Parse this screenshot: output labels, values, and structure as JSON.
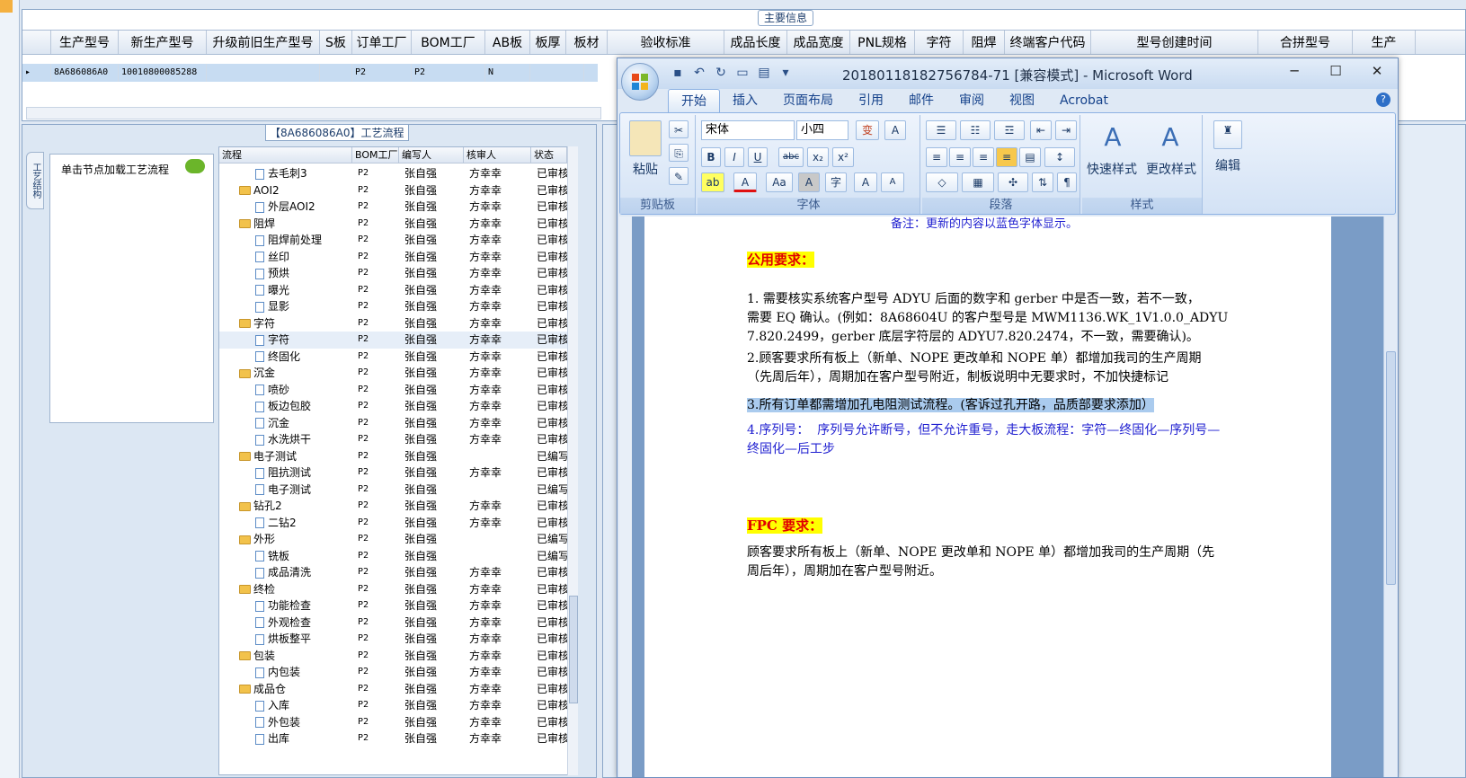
{
  "main_grid": {
    "section_label": "主要信息",
    "columns": [
      "生产型号",
      "新生产型号",
      "升级前旧生产型号",
      "S板",
      "订单工厂",
      "BOM工厂",
      "AB板",
      "板厚",
      "板材",
      "验收标准",
      "成品长度",
      "成品宽度",
      "PNL规格",
      "字符",
      "阻焊",
      "终端客户代码",
      "型号创建时间",
      "合拼型号",
      "生产"
    ],
    "row": {
      "marker": "▸",
      "model": "8A686086A0",
      "new_model": "10010800085288",
      "order_factory": "P2",
      "bom_factory": "P2",
      "ab": "N"
    }
  },
  "process_panel": {
    "title": "【8A686086A0】工艺流程",
    "vertical_tab": "工艺结构",
    "hint": "单击节点加载工艺流程",
    "headers": [
      "流程",
      "BOM工厂",
      "编写人",
      "核审人",
      "状态"
    ],
    "rows": [
      {
        "level": 2,
        "type": "doc",
        "name": "去毛刺3",
        "bom": "P2",
        "writer": "张自强",
        "checker": "方幸幸",
        "status": "已审核"
      },
      {
        "level": 1,
        "type": "folder",
        "name": "AOI2",
        "bom": "P2",
        "writer": "张自强",
        "checker": "方幸幸",
        "status": "已审核"
      },
      {
        "level": 2,
        "type": "doc",
        "name": "外层AOI2",
        "bom": "P2",
        "writer": "张自强",
        "checker": "方幸幸",
        "status": "已审核"
      },
      {
        "level": 1,
        "type": "folder",
        "name": "阻焊",
        "bom": "P2",
        "writer": "张自强",
        "checker": "方幸幸",
        "status": "已审核"
      },
      {
        "level": 2,
        "type": "doc",
        "name": "阻焊前处理",
        "bom": "P2",
        "writer": "张自强",
        "checker": "方幸幸",
        "status": "已审核"
      },
      {
        "level": 2,
        "type": "doc",
        "name": "丝印",
        "bom": "P2",
        "writer": "张自强",
        "checker": "方幸幸",
        "status": "已审核"
      },
      {
        "level": 2,
        "type": "doc",
        "name": "预烘",
        "bom": "P2",
        "writer": "张自强",
        "checker": "方幸幸",
        "status": "已审核"
      },
      {
        "level": 2,
        "type": "doc",
        "name": "曝光",
        "bom": "P2",
        "writer": "张自强",
        "checker": "方幸幸",
        "status": "已审核"
      },
      {
        "level": 2,
        "type": "doc",
        "name": "显影",
        "bom": "P2",
        "writer": "张自强",
        "checker": "方幸幸",
        "status": "已审核"
      },
      {
        "level": 1,
        "type": "folder",
        "name": "字符",
        "bom": "P2",
        "writer": "张自强",
        "checker": "方幸幸",
        "status": "已审核"
      },
      {
        "level": 2,
        "type": "doc",
        "name": "字符",
        "bom": "P2",
        "writer": "张自强",
        "checker": "方幸幸",
        "status": "已审核"
      },
      {
        "level": 2,
        "type": "doc",
        "name": "终固化",
        "bom": "P2",
        "writer": "张自强",
        "checker": "方幸幸",
        "status": "已审核"
      },
      {
        "level": 1,
        "type": "folder",
        "name": "沉金",
        "bom": "P2",
        "writer": "张自强",
        "checker": "方幸幸",
        "status": "已审核"
      },
      {
        "level": 2,
        "type": "doc",
        "name": "喷砂",
        "bom": "P2",
        "writer": "张自强",
        "checker": "方幸幸",
        "status": "已审核"
      },
      {
        "level": 2,
        "type": "doc",
        "name": "板边包胶",
        "bom": "P2",
        "writer": "张自强",
        "checker": "方幸幸",
        "status": "已审核"
      },
      {
        "level": 2,
        "type": "doc",
        "name": "沉金",
        "bom": "P2",
        "writer": "张自强",
        "checker": "方幸幸",
        "status": "已审核"
      },
      {
        "level": 2,
        "type": "doc",
        "name": "水洗烘干",
        "bom": "P2",
        "writer": "张自强",
        "checker": "方幸幸",
        "status": "已审核"
      },
      {
        "level": 1,
        "type": "folder",
        "name": "电子测试",
        "bom": "P2",
        "writer": "张自强",
        "checker": "",
        "status": "已编写"
      },
      {
        "level": 2,
        "type": "doc",
        "name": "阻抗测试",
        "bom": "P2",
        "writer": "张自强",
        "checker": "方幸幸",
        "status": "已审核"
      },
      {
        "level": 2,
        "type": "doc",
        "name": "电子测试",
        "bom": "P2",
        "writer": "张自强",
        "checker": "",
        "status": "已编写"
      },
      {
        "level": 1,
        "type": "folder",
        "name": "钻孔2",
        "bom": "P2",
        "writer": "张自强",
        "checker": "方幸幸",
        "status": "已审核"
      },
      {
        "level": 2,
        "type": "doc",
        "name": "二钻2",
        "bom": "P2",
        "writer": "张自强",
        "checker": "方幸幸",
        "status": "已审核"
      },
      {
        "level": 1,
        "type": "folder",
        "name": "外形",
        "bom": "P2",
        "writer": "张自强",
        "checker": "",
        "status": "已编写"
      },
      {
        "level": 2,
        "type": "doc",
        "name": "铣板",
        "bom": "P2",
        "writer": "张自强",
        "checker": "",
        "status": "已编写"
      },
      {
        "level": 2,
        "type": "doc",
        "name": "成品清洗",
        "bom": "P2",
        "writer": "张自强",
        "checker": "方幸幸",
        "status": "已审核"
      },
      {
        "level": 1,
        "type": "folder",
        "name": "终检",
        "bom": "P2",
        "writer": "张自强",
        "checker": "方幸幸",
        "status": "已审核"
      },
      {
        "level": 2,
        "type": "doc",
        "name": "功能检查",
        "bom": "P2",
        "writer": "张自强",
        "checker": "方幸幸",
        "status": "已审核"
      },
      {
        "level": 2,
        "type": "doc",
        "name": "外观检查",
        "bom": "P2",
        "writer": "张自强",
        "checker": "方幸幸",
        "status": "已审核"
      },
      {
        "level": 2,
        "type": "doc",
        "name": "烘板整平",
        "bom": "P2",
        "writer": "张自强",
        "checker": "方幸幸",
        "status": "已审核"
      },
      {
        "level": 1,
        "type": "folder",
        "name": "包装",
        "bom": "P2",
        "writer": "张自强",
        "checker": "方幸幸",
        "status": "已审核"
      },
      {
        "level": 2,
        "type": "doc",
        "name": "内包装",
        "bom": "P2",
        "writer": "张自强",
        "checker": "方幸幸",
        "status": "已审核"
      },
      {
        "level": 1,
        "type": "folder",
        "name": "成品仓",
        "bom": "P2",
        "writer": "张自强",
        "checker": "方幸幸",
        "status": "已审核"
      },
      {
        "level": 2,
        "type": "doc",
        "name": "入库",
        "bom": "P2",
        "writer": "张自强",
        "checker": "方幸幸",
        "status": "已审核"
      },
      {
        "level": 2,
        "type": "doc",
        "name": "外包装",
        "bom": "P2",
        "writer": "张自强",
        "checker": "方幸幸",
        "status": "已审核"
      },
      {
        "level": 2,
        "type": "doc",
        "name": "出库",
        "bom": "P2",
        "writer": "张自强",
        "checker": "方幸幸",
        "status": "已审核"
      }
    ]
  },
  "word": {
    "title": "20180118182756784-71 [兼容模式] - Microsoft Word",
    "tabs": [
      "开始",
      "插入",
      "页面布局",
      "引用",
      "邮件",
      "审阅",
      "视图",
      "Acrobat"
    ],
    "ribbon": {
      "paste": "粘贴",
      "clipboard": "剪贴板",
      "font_name": "宋体",
      "font_size": "小四",
      "font_group": "字体",
      "paragraph_group": "段落",
      "quick_styles": "快速样式",
      "change_styles": "更改样式",
      "styles_group": "样式",
      "edit": "编辑",
      "bold": "B",
      "italic": "I",
      "underline": "U",
      "strike": "abc",
      "sub": "x₂",
      "sup": "x²",
      "font_color": "A",
      "case": "Aa",
      "grow": "A",
      "shrink": "A"
    },
    "doc": {
      "note": "备注：更新的内容以蓝色字体显示。",
      "h_common": "公用要求：",
      "p1": "1. 需要核实系统客户型号 ADYU 后面的数字和 gerber 中是否一致，若不一致，\n需要 EQ 确认。(例如：8A68604U 的客户型号是 MWM1136.WK_1V1.0.0_ADYU\n7.820.2499，gerber 底层字符层的 ADYU7.820.2474，不一致，需要确认)。",
      "p2": "2.顾客要求所有板上（新单、NOPE 更改单和 NOPE 单）都增加我司的生产周期\n（先周后年），周期加在客户型号附近，制板说明中无要求时，不加快捷标记",
      "p3": "3.所有订单都需增加孔电阻测试流程。(客诉过孔开路，品质部要求添加）",
      "p4": "4.序列号：  序列号允许断号，但不允许重号，走大板流程：字符—终固化—序列号—\n终固化—后工步",
      "h_fpc": "FPC 要求：",
      "p5": "顾客要求所有板上（新单、NOPE 更改单和 NOPE 单）都增加我司的生产周期（先\n周后年），周期加在客户型号附近。"
    }
  }
}
